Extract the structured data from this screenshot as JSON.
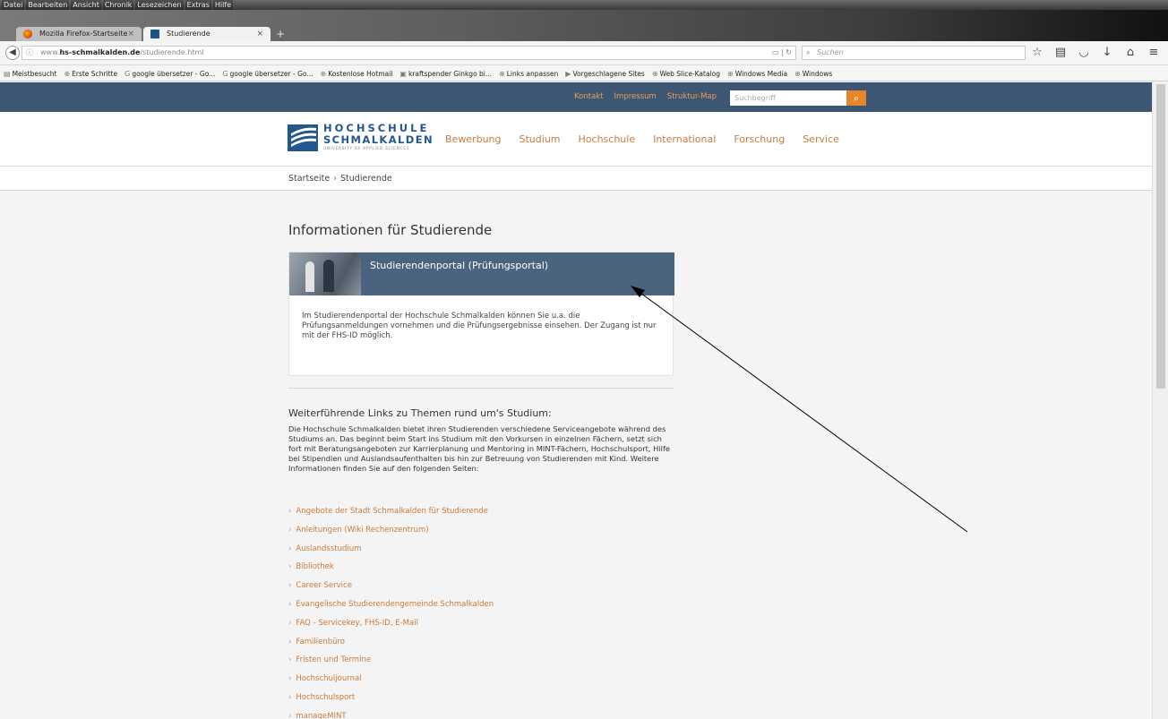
{
  "browser": {
    "menu": [
      "Datei",
      "Bearbeiten",
      "Ansicht",
      "Chronik",
      "Lesezeichen",
      "Extras",
      "Hilfe"
    ],
    "tabs": [
      {
        "label": "Mozilla Firefox-Startseite",
        "close": "×"
      },
      {
        "label": "Studierende",
        "close": "×"
      }
    ],
    "new_tab": "+",
    "url_prefix": "www.",
    "url_domain": "hs-schmalkalden.de",
    "url_path": "/studierende.html",
    "search_placeholder": "Suchen",
    "bookmarks": [
      "Meistbesucht",
      "Erste Schritte",
      "google übersetzer - Go...",
      "google übersetzer - Go...",
      "Kostenlose Hotmail",
      "kraftspender Ginkgo bi...",
      "Links anpassen",
      "Vorgeschlagene Sites",
      "Web Slice-Katalog",
      "Windows Media",
      "Windows"
    ]
  },
  "site": {
    "toplinks": [
      "Kontakt",
      "Impressum",
      "Struktur-Map"
    ],
    "search_placeholder": "Suchbegriff",
    "logo": {
      "line1": "HOCHSCHULE",
      "line2": "SCHMALKALDEN",
      "line3": "UNIVERSITY OF APPLIED SCIENCES"
    },
    "nav": [
      "Bewerbung",
      "Studium",
      "Hochschule",
      "International",
      "Forschung",
      "Service"
    ],
    "breadcrumb": {
      "home": "Startseite",
      "sep": "›",
      "current": "Studierende"
    }
  },
  "content": {
    "title": "Informationen für Studierende",
    "card": {
      "title": "Studierendenportal (Prüfungsportal)",
      "body": "Im Studierendenportal der Hochschule Schmalkalden können Sie u.a. die Prüfungsanmeldungen vornehmen und die Prüfungsergebnisse einsehen. Der Zugang ist nur mit der FHS-ID möglich."
    },
    "links_heading": "Weiterführende Links zu Themen rund um's Studium:",
    "intro": "Die Hochschule Schmalkalden bietet ihren Studierenden verschiedene Serviceangebote während des Studiums an. Das beginnt beim Start ins Studium mit den Vorkursen in einzelnen Fächern, setzt sich fort mit Beratungsangeboten zur Karrierplanung und Mentoring in MINT-Fächern, Hochschulsport, Hilfe bei Stipendien und Auslandsaufenthalten bis hin zur Betreuung von Studierenden mit Kind. Weitere Informationen finden Sie auf den folgenden Seiten:",
    "links": [
      "Angebote der Stadt Schmalkalden für Studierende",
      "Anleitungen (Wiki Rechenzentrum)",
      "Auslandsstudium",
      "Bibliothek",
      "Career Service",
      "Evangelische Studierendengemeinde Schmalkalden",
      "FAQ - Servicekey, FHS-ID, E-Mail",
      "Familienbüro",
      "Fristen und Termine",
      "Hochschuljournal",
      "Hochschulsport",
      "manageMINT"
    ]
  },
  "colors": {
    "brand": "#24578e",
    "accent": "#c97a3a",
    "topbar": "#3c5673",
    "card_head": "#4a6480"
  }
}
